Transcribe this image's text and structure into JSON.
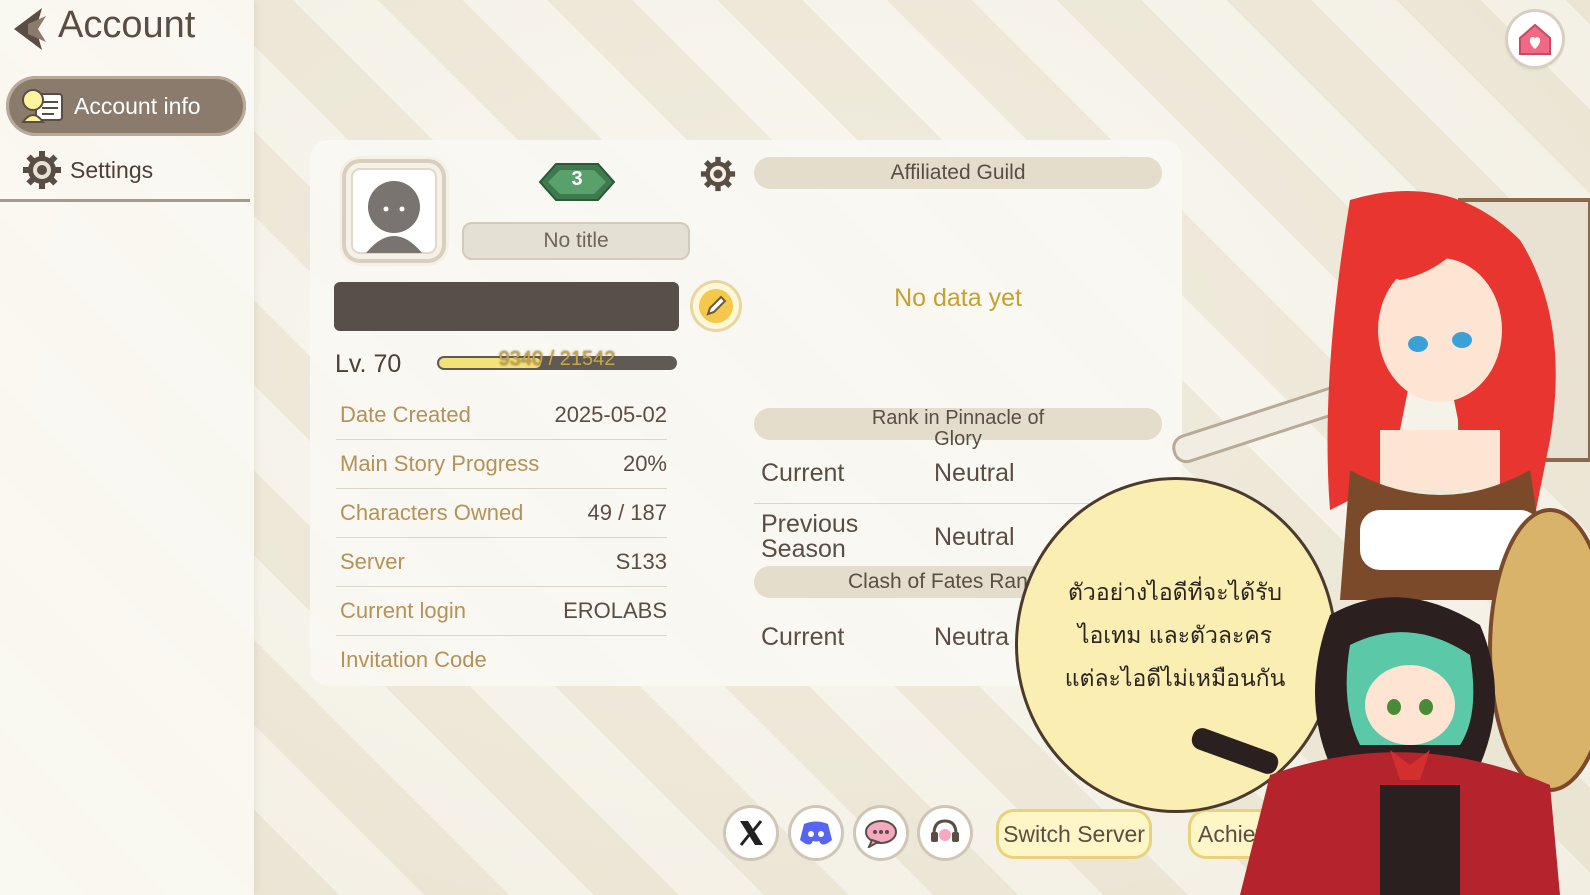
{
  "header": {
    "title": "Account"
  },
  "sidebar": {
    "items": [
      {
        "label": "Account info",
        "active": true
      },
      {
        "label": "Settings",
        "active": false
      }
    ]
  },
  "profile": {
    "badge_number": "3",
    "title": "No title",
    "level": "Lv. 70",
    "exp_text": "9340 / 21542",
    "exp_current": 9340,
    "exp_max": 21542
  },
  "stats": [
    {
      "label": "Date Created",
      "value": "2025-05-02"
    },
    {
      "label": "Main Story Progress",
      "value": "20%"
    },
    {
      "label": "Characters Owned",
      "value": "49 / 187"
    },
    {
      "label": "Server",
      "value": "S133"
    },
    {
      "label": "Current login",
      "value": "EROLABS"
    },
    {
      "label": "Invitation Code",
      "value": ""
    }
  ],
  "guild": {
    "header": "Affiliated Guild",
    "status": "No data yet"
  },
  "pinnacle": {
    "header": "Rank in Pinnacle of Glory",
    "current_label": "Current",
    "current_value": "Neutral",
    "previous_label": "Previous Season",
    "previous_value": "Neutral"
  },
  "clash": {
    "header": "Clash of Fates Ran",
    "current_label": "Current",
    "current_value": "Neutra"
  },
  "bottom": {
    "switch_server": "Switch Server",
    "achievements": "Achieve"
  },
  "overlay": {
    "lines": [
      "ตัวอย่างไอดีที่จะได้รับ",
      "ไอเทม และตัวละคร",
      "แต่ละไอดีไม่เหมือนกัน"
    ]
  },
  "colors": {
    "accent_gold": "#c7a12e",
    "label_gold": "#b49258",
    "sidebar_active": "#8a7b6c"
  }
}
